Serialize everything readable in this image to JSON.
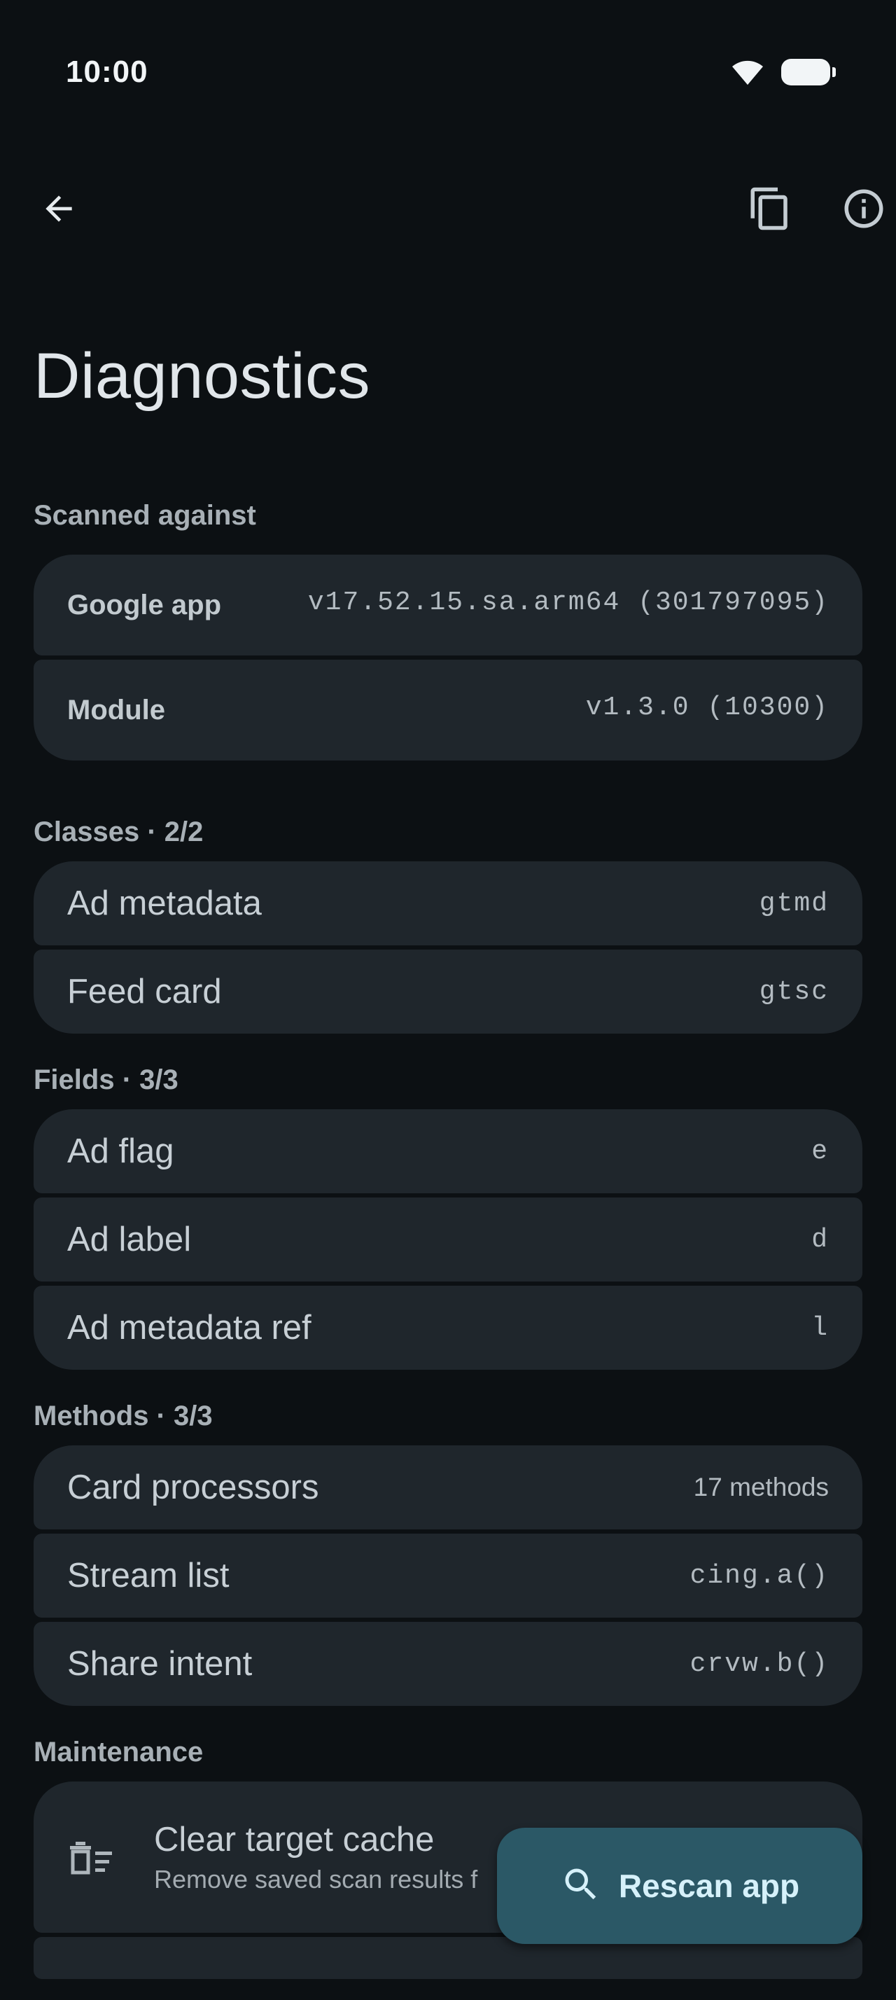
{
  "status_bar": {
    "time": "10:00"
  },
  "top_bar": {
    "back": "back-arrow-icon",
    "copy": "copy-icon",
    "info": "info-icon"
  },
  "page_title": "Diagnostics",
  "sections": {
    "scanned": {
      "label": "Scanned against",
      "rows": [
        {
          "label": "Google app",
          "value": "v17.52.15.sa.arm64 (301797095)"
        },
        {
          "label": "Module",
          "value": "v1.3.0 (10300)"
        }
      ]
    },
    "classes": {
      "label": "Classes · 2/2",
      "rows": [
        {
          "label": "Ad metadata",
          "value": "gtmd"
        },
        {
          "label": "Feed card",
          "value": "gtsc"
        }
      ]
    },
    "fields": {
      "label": "Fields · 3/3",
      "rows": [
        {
          "label": "Ad flag",
          "value": "e"
        },
        {
          "label": "Ad label",
          "value": "d"
        },
        {
          "label": "Ad metadata ref",
          "value": "l"
        }
      ]
    },
    "methods": {
      "label": "Methods · 3/3",
      "rows": [
        {
          "label": "Card processors",
          "value": "17 methods"
        },
        {
          "label": "Stream list",
          "value": "cing.a()"
        },
        {
          "label": "Share intent",
          "value": "crvw.b()"
        }
      ]
    },
    "maintenance": {
      "label": "Maintenance",
      "clear_cache": {
        "title": "Clear target cache",
        "subtitle": "Remove saved scan results f"
      }
    }
  },
  "fab": {
    "label": "Rescan app",
    "icon": "search-icon"
  },
  "colors": {
    "background": "#0c1013",
    "card": "#1f262c",
    "fab": "#2b5866",
    "fab_text": "#d6f1fa"
  }
}
